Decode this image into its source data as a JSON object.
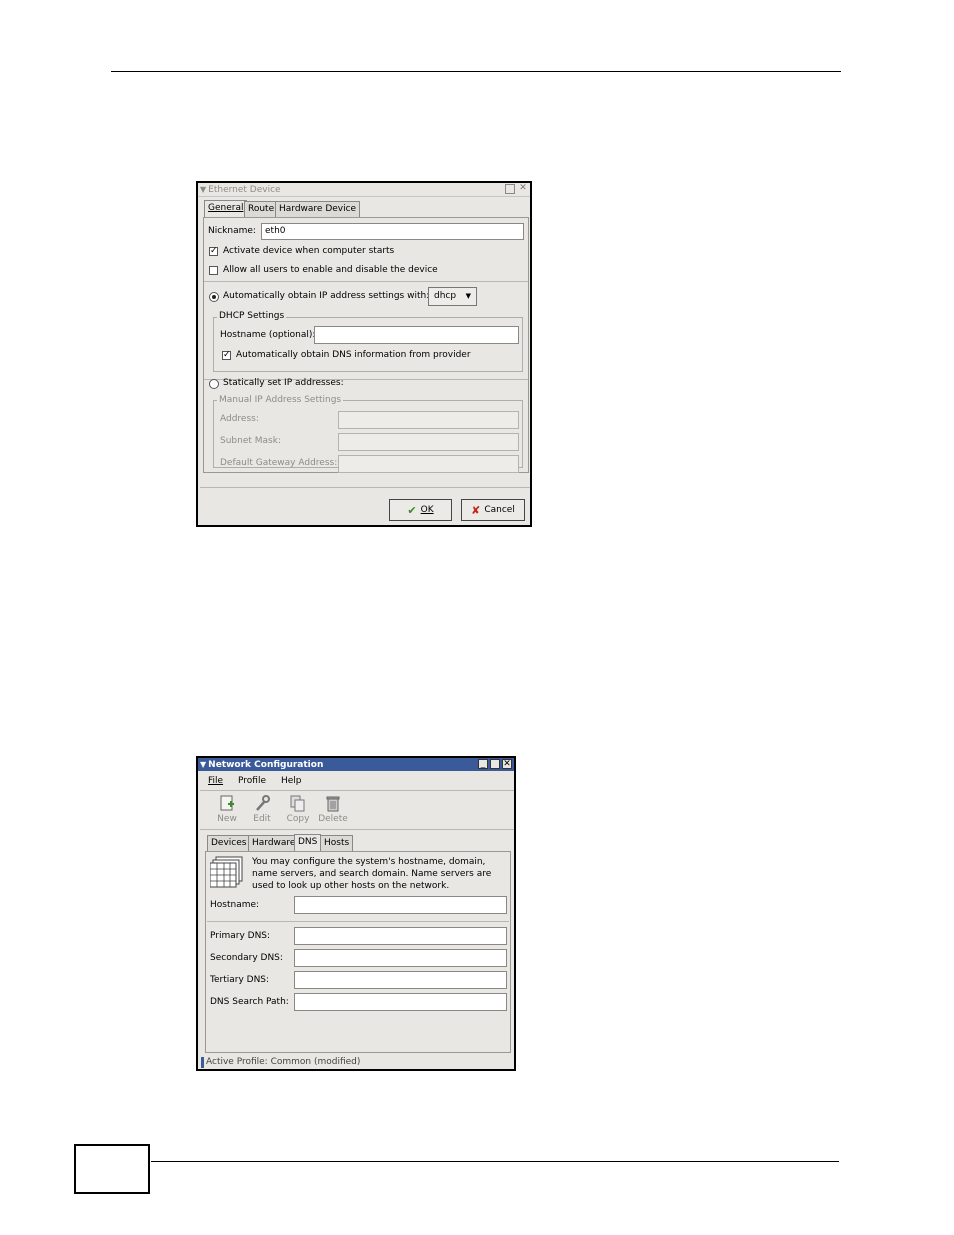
{
  "ethernet_dialog": {
    "title": "Ethernet Device",
    "tabs": [
      "General",
      "Route",
      "Hardware Device"
    ],
    "nickname_label": "Nickname:",
    "nickname_value": "eth0",
    "activate_label": "Activate device when computer starts",
    "activate_checked": true,
    "allow_users_label": "Allow all users to enable and disable the device",
    "allow_users_checked": false,
    "auto_ip_label": "Automatically obtain IP address settings with:",
    "auto_ip_selected": true,
    "protocol_value": "dhcp",
    "dhcp_frame_title": "DHCP Settings",
    "hostname_label": "Hostname (optional):",
    "hostname_value": "",
    "auto_dns_label": "Automatically obtain DNS information from provider",
    "auto_dns_checked": true,
    "static_ip_label": "Statically set IP addresses:",
    "static_ip_selected": false,
    "manual_frame_title": "Manual IP Address Settings",
    "address_label": "Address:",
    "subnet_label": "Subnet Mask:",
    "gateway_label": "Default Gateway Address:",
    "ok_label": "OK",
    "cancel_label": "Cancel"
  },
  "network_config": {
    "title": "Network Configuration",
    "menu": [
      "File",
      "Profile",
      "Help"
    ],
    "toolbar": [
      "New",
      "Edit",
      "Copy",
      "Delete"
    ],
    "tabs": [
      "Devices",
      "Hardware",
      "DNS",
      "Hosts"
    ],
    "active_tab": "DNS",
    "info_text_1": "You may configure the system's hostname, domain,",
    "info_text_2": "name servers, and search domain. Name servers are",
    "info_text_3": "used to look up other hosts on the network.",
    "hostname_label": "Hostname:",
    "primary_dns_label": "Primary DNS:",
    "secondary_dns_label": "Secondary DNS:",
    "tertiary_dns_label": "Tertiary DNS:",
    "search_path_label": "DNS Search Path:",
    "status_text": "Active Profile: Common (modified)"
  },
  "colors": {
    "title_active": "#3b5a9a",
    "title_inactive": "#e9e7e3",
    "window_bg": "#e9e7e3"
  }
}
